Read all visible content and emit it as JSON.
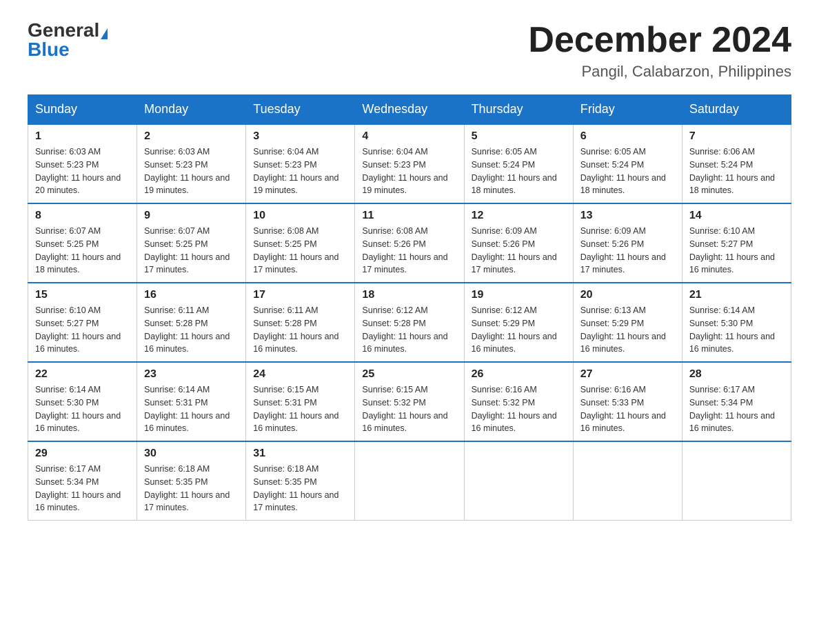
{
  "header": {
    "logo_general": "General",
    "logo_blue": "Blue",
    "month_title": "December 2024",
    "location": "Pangil, Calabarzon, Philippines"
  },
  "days_of_week": [
    "Sunday",
    "Monday",
    "Tuesday",
    "Wednesday",
    "Thursday",
    "Friday",
    "Saturday"
  ],
  "weeks": [
    [
      {
        "num": "1",
        "sunrise": "6:03 AM",
        "sunset": "5:23 PM",
        "daylight": "11 hours and 20 minutes."
      },
      {
        "num": "2",
        "sunrise": "6:03 AM",
        "sunset": "5:23 PM",
        "daylight": "11 hours and 19 minutes."
      },
      {
        "num": "3",
        "sunrise": "6:04 AM",
        "sunset": "5:23 PM",
        "daylight": "11 hours and 19 minutes."
      },
      {
        "num": "4",
        "sunrise": "6:04 AM",
        "sunset": "5:23 PM",
        "daylight": "11 hours and 19 minutes."
      },
      {
        "num": "5",
        "sunrise": "6:05 AM",
        "sunset": "5:24 PM",
        "daylight": "11 hours and 18 minutes."
      },
      {
        "num": "6",
        "sunrise": "6:05 AM",
        "sunset": "5:24 PM",
        "daylight": "11 hours and 18 minutes."
      },
      {
        "num": "7",
        "sunrise": "6:06 AM",
        "sunset": "5:24 PM",
        "daylight": "11 hours and 18 minutes."
      }
    ],
    [
      {
        "num": "8",
        "sunrise": "6:07 AM",
        "sunset": "5:25 PM",
        "daylight": "11 hours and 18 minutes."
      },
      {
        "num": "9",
        "sunrise": "6:07 AM",
        "sunset": "5:25 PM",
        "daylight": "11 hours and 17 minutes."
      },
      {
        "num": "10",
        "sunrise": "6:08 AM",
        "sunset": "5:25 PM",
        "daylight": "11 hours and 17 minutes."
      },
      {
        "num": "11",
        "sunrise": "6:08 AM",
        "sunset": "5:26 PM",
        "daylight": "11 hours and 17 minutes."
      },
      {
        "num": "12",
        "sunrise": "6:09 AM",
        "sunset": "5:26 PM",
        "daylight": "11 hours and 17 minutes."
      },
      {
        "num": "13",
        "sunrise": "6:09 AM",
        "sunset": "5:26 PM",
        "daylight": "11 hours and 17 minutes."
      },
      {
        "num": "14",
        "sunrise": "6:10 AM",
        "sunset": "5:27 PM",
        "daylight": "11 hours and 16 minutes."
      }
    ],
    [
      {
        "num": "15",
        "sunrise": "6:10 AM",
        "sunset": "5:27 PM",
        "daylight": "11 hours and 16 minutes."
      },
      {
        "num": "16",
        "sunrise": "6:11 AM",
        "sunset": "5:28 PM",
        "daylight": "11 hours and 16 minutes."
      },
      {
        "num": "17",
        "sunrise": "6:11 AM",
        "sunset": "5:28 PM",
        "daylight": "11 hours and 16 minutes."
      },
      {
        "num": "18",
        "sunrise": "6:12 AM",
        "sunset": "5:28 PM",
        "daylight": "11 hours and 16 minutes."
      },
      {
        "num": "19",
        "sunrise": "6:12 AM",
        "sunset": "5:29 PM",
        "daylight": "11 hours and 16 minutes."
      },
      {
        "num": "20",
        "sunrise": "6:13 AM",
        "sunset": "5:29 PM",
        "daylight": "11 hours and 16 minutes."
      },
      {
        "num": "21",
        "sunrise": "6:14 AM",
        "sunset": "5:30 PM",
        "daylight": "11 hours and 16 minutes."
      }
    ],
    [
      {
        "num": "22",
        "sunrise": "6:14 AM",
        "sunset": "5:30 PM",
        "daylight": "11 hours and 16 minutes."
      },
      {
        "num": "23",
        "sunrise": "6:14 AM",
        "sunset": "5:31 PM",
        "daylight": "11 hours and 16 minutes."
      },
      {
        "num": "24",
        "sunrise": "6:15 AM",
        "sunset": "5:31 PM",
        "daylight": "11 hours and 16 minutes."
      },
      {
        "num": "25",
        "sunrise": "6:15 AM",
        "sunset": "5:32 PM",
        "daylight": "11 hours and 16 minutes."
      },
      {
        "num": "26",
        "sunrise": "6:16 AM",
        "sunset": "5:32 PM",
        "daylight": "11 hours and 16 minutes."
      },
      {
        "num": "27",
        "sunrise": "6:16 AM",
        "sunset": "5:33 PM",
        "daylight": "11 hours and 16 minutes."
      },
      {
        "num": "28",
        "sunrise": "6:17 AM",
        "sunset": "5:34 PM",
        "daylight": "11 hours and 16 minutes."
      }
    ],
    [
      {
        "num": "29",
        "sunrise": "6:17 AM",
        "sunset": "5:34 PM",
        "daylight": "11 hours and 16 minutes."
      },
      {
        "num": "30",
        "sunrise": "6:18 AM",
        "sunset": "5:35 PM",
        "daylight": "11 hours and 17 minutes."
      },
      {
        "num": "31",
        "sunrise": "6:18 AM",
        "sunset": "5:35 PM",
        "daylight": "11 hours and 17 minutes."
      },
      null,
      null,
      null,
      null
    ]
  ],
  "labels": {
    "sunrise_prefix": "Sunrise: ",
    "sunset_prefix": "Sunset: ",
    "daylight_prefix": "Daylight: "
  }
}
